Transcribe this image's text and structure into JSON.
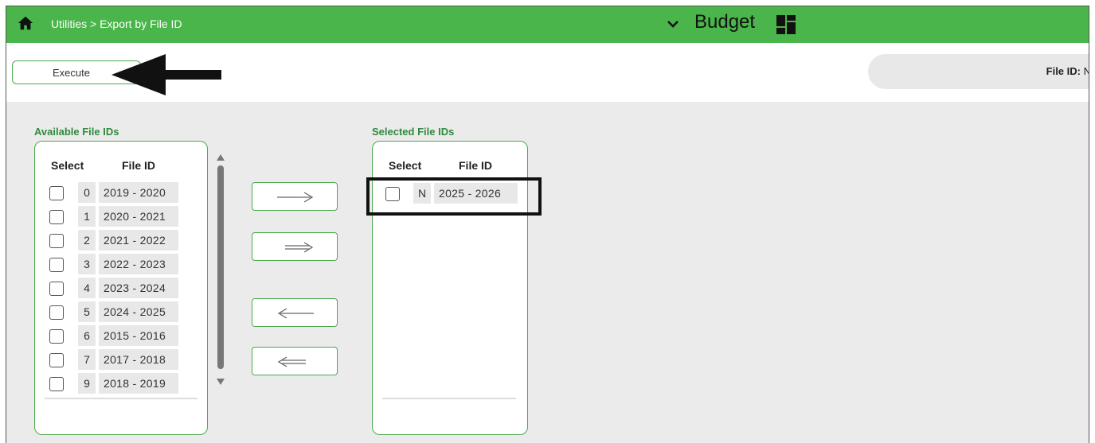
{
  "header": {
    "breadcrumb": "Utilities > Export by File ID",
    "app_name": "Budget",
    "bg_color": "#49b54a"
  },
  "toolbar": {
    "execute_label": "Execute",
    "file_id_label": "File ID:",
    "file_id_value": "N"
  },
  "available": {
    "title": "Available File IDs",
    "col_select": "Select",
    "col_file_id": "File ID",
    "rows": [
      {
        "key": "0",
        "years": "2019 - 2020"
      },
      {
        "key": "1",
        "years": "2020 - 2021"
      },
      {
        "key": "2",
        "years": "2021 - 2022"
      },
      {
        "key": "3",
        "years": "2022 - 2023"
      },
      {
        "key": "4",
        "years": "2023 - 2024"
      },
      {
        "key": "5",
        "years": "2024 - 2025"
      },
      {
        "key": "6",
        "years": "2015 - 2016"
      },
      {
        "key": "7",
        "years": "2017 - 2018"
      },
      {
        "key": "9",
        "years": "2018 - 2019"
      }
    ]
  },
  "selected": {
    "title": "Selected File IDs",
    "col_select": "Select",
    "col_file_id": "File ID",
    "rows": [
      {
        "key": "N",
        "years": "2025 - 2026"
      }
    ]
  },
  "move_buttons": [
    "move-selected-right",
    "move-all-right",
    "move-selected-left",
    "move-all-left"
  ],
  "colors": {
    "accent": "#4aa94b",
    "title_green": "#2e8b3d",
    "panel_bg": "#ebebeb"
  }
}
